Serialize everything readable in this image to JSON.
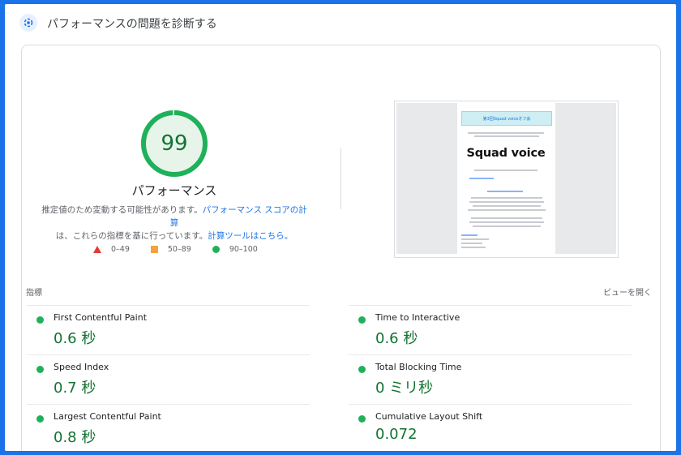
{
  "header": {
    "title": "パフォーマンスの問題を診断する",
    "icon": "gauge-icon"
  },
  "score": {
    "value": "99",
    "percent": 99,
    "label": "パフォーマンス",
    "color": "#0c7c3a",
    "ring_color": "#1fb15a",
    "ring_bg": "#c7ecd3"
  },
  "description": {
    "text1": "推定値のため変動する可能性があります。",
    "link1": "パフォーマンス スコアの計算",
    "text2": "は、これらの指標を基に行っています。",
    "link2": "計算ツールはこちら。"
  },
  "legend": [
    {
      "range": "0–49",
      "shape": "triangle",
      "color": "#e53935"
    },
    {
      "range": "50–89",
      "shape": "square",
      "color": "#f4a33a"
    },
    {
      "range": "90–100",
      "shape": "circle",
      "color": "#1fb15a"
    }
  ],
  "screenshot": {
    "banner": "第3回Squad voiceオフ会",
    "hero_title": "Squad voice"
  },
  "metrics_section": {
    "label": "指標",
    "toggle": "ビューを開く"
  },
  "metrics": [
    {
      "name": "First Contentful Paint",
      "value": "0.6 秒"
    },
    {
      "name": "Time to Interactive",
      "value": "0.6 秒"
    },
    {
      "name": "Speed Index",
      "value": "0.7 秒"
    },
    {
      "name": "Total Blocking Time",
      "value": "0 ミリ秒"
    },
    {
      "name": "Largest Contentful Paint",
      "value": "0.8 秒"
    },
    {
      "name": "Cumulative Layout Shift",
      "value": "0.072"
    }
  ]
}
